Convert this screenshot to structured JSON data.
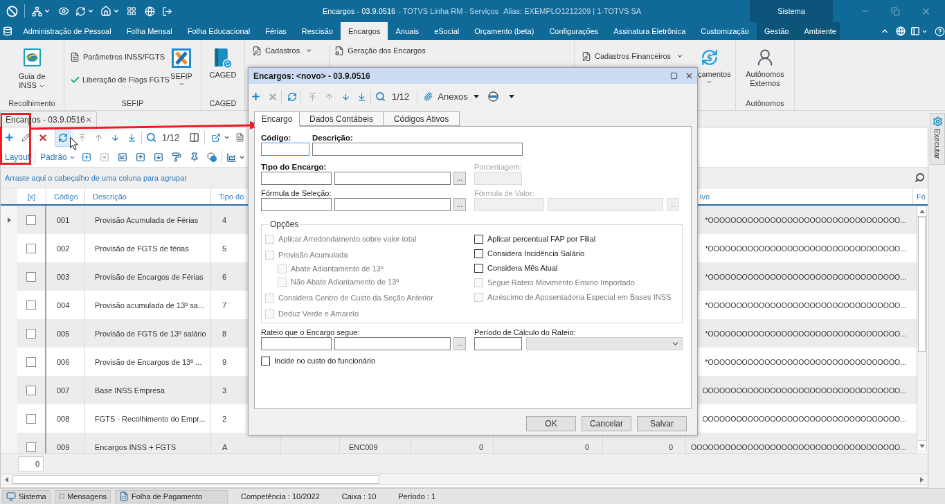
{
  "titlebar": {
    "document": "Encargos - 03.9.0516",
    "app": "- TOTVS Linha RM - Serviços",
    "alias": "Alias: EXEMPLO1212209 | 1-TOTVS SA",
    "context": "Sistema"
  },
  "menu": [
    {
      "label": "Administração de Pessoal",
      "selected": false,
      "contextual": false
    },
    {
      "label": "Folha Mensal",
      "selected": false,
      "contextual": false
    },
    {
      "label": "Folha Educacional",
      "selected": false,
      "contextual": false
    },
    {
      "label": "Férias",
      "selected": false,
      "contextual": false
    },
    {
      "label": "Rescisão",
      "selected": false,
      "contextual": false
    },
    {
      "label": "Encargos",
      "selected": true,
      "contextual": false
    },
    {
      "label": "Anuais",
      "selected": false,
      "contextual": false
    },
    {
      "label": "eSocial",
      "selected": false,
      "contextual": false
    },
    {
      "label": "Orçamento (beta)",
      "selected": false,
      "contextual": false
    },
    {
      "label": "Configurações",
      "selected": false,
      "contextual": false
    },
    {
      "label": "Assinatura Eletrônica",
      "selected": false,
      "contextual": false
    },
    {
      "label": "Customização",
      "selected": false,
      "contextual": false
    },
    {
      "label": "Gestão",
      "selected": false,
      "contextual": true
    },
    {
      "label": "Ambiente",
      "selected": false,
      "contextual": true
    }
  ],
  "ribbon": {
    "groups": [
      {
        "label": "Recolhimento",
        "items": [
          {
            "label": "Guia de INSS",
            "dropdown": true
          }
        ]
      },
      {
        "label": "SEFIP",
        "items": [
          {
            "label": "Parâmetros INSS/FGTS",
            "dropdown": false
          },
          {
            "label": "Liberação de Flags FGTS",
            "dropdown": false
          },
          {
            "label": "SEFIP",
            "dropdown": true
          }
        ]
      },
      {
        "label": "CAGED",
        "items": [
          {
            "label": "CAGED",
            "dropdown": false
          }
        ]
      },
      {
        "items": [
          {
            "label": "Cadastros",
            "dropdown": true
          },
          {
            "label": "Geração dos Encargos",
            "dropdown": false
          }
        ]
      },
      {
        "items": [
          {
            "label": "Cadastros Financeiros",
            "dropdown": true
          },
          {
            "label": "çamentos",
            "dropdown": true
          }
        ]
      },
      {
        "label": "Autônomos",
        "items": [
          {
            "label": "Autônomos Externos",
            "dropdown": false
          }
        ]
      }
    ]
  },
  "document_tab": {
    "label": "Encargos - 03.9.0516"
  },
  "grid_toolbar": {
    "counter": "1/12",
    "layout": "Layout",
    "view": "Padrão"
  },
  "grid": {
    "group_hint": "Arraste aqui o cabeçalho de uma coluna para agrupar",
    "columns": {
      "selector": "[x]",
      "code": "Código",
      "description": "Descrição",
      "column_4": "Tipo do",
      "column_10": "ivo",
      "column_11": "Fó"
    },
    "rows": [
      {
        "focused": true,
        "checked": false,
        "code": "001",
        "description": "Provisão Acumulada de Férias",
        "column_4": "4",
        "column_10": "*OOOOOOOOOOOOOOOOOOOOOOOOOOOOOOOOOO..."
      },
      {
        "focused": false,
        "checked": false,
        "code": "002",
        "description": "Provisão de FGTS de férias",
        "column_4": "5",
        "column_10": "*OOOOOOOOOOOOOOOOOOOOOOOOOOOOOOOOOO..."
      },
      {
        "focused": false,
        "checked": false,
        "code": "003",
        "description": "Provisão de Encargos de Férias",
        "column_4": "6",
        "column_10": "*OOOOOOOOOOOOOOOOOOOOOOOOOOOOOOOOOO..."
      },
      {
        "focused": false,
        "checked": false,
        "code": "004",
        "description": "Provisão acumulada de 13º sa...",
        "column_4": "7",
        "column_10": "*OOOOOOOOOOOOOOOOOOOOOOOOOOOOOOOOOO..."
      },
      {
        "focused": false,
        "checked": false,
        "code": "005",
        "description": "Provisão de FGTS de 13º salário",
        "column_4": "8",
        "column_10": "*OOOOOOOOOOOOOOOOOOOOOOOOOOOOOOOOOO..."
      },
      {
        "focused": false,
        "checked": false,
        "code": "006",
        "description": "Provisão de Encargos de 13º ...",
        "column_4": "9",
        "column_10": "*OOOOOOOOOOOOOOOOOOOOOOOOOOOOOOOOOO..."
      },
      {
        "focused": false,
        "checked": false,
        "code": "007",
        "description": "Base INSS Empresa",
        "column_4": "3",
        "column_10": "OOOOOOOOOOOOOOOOOOOOOOOOOOOOOOOOOOO..."
      },
      {
        "focused": false,
        "checked": false,
        "code": "008",
        "description": "FGTS - Recolhimento do Empr...",
        "column_4": "2",
        "column_10": "OOOOOOOOOOOOOOOOOOOOOOOOOOOOOOOOOOO..."
      },
      {
        "focused": false,
        "checked": false,
        "code": "009",
        "description": "Encargos INSS + FGTS",
        "column_4": "A",
        "column_6": "ENC009",
        "column_7": "0",
        "column_8": "0",
        "column_9": "0",
        "column_10": "OOOOOOOOOOOOOOOOOOOOOOOOOOOOOOOOOOOOO..."
      }
    ],
    "footer": "0"
  },
  "side_panel": {
    "label": "Executar"
  },
  "dialog": {
    "title": "Encargos: <novo> - 03.9.0516",
    "counter": "1/12",
    "attachments": "Anexos",
    "tabs": [
      {
        "label": "Encargo",
        "selected": true
      },
      {
        "label": "Dados Contábeis",
        "selected": false
      },
      {
        "label": "Códigos Ativos",
        "selected": false
      }
    ],
    "code": {
      "label": "Código:",
      "required": true,
      "focused": true
    },
    "description": {
      "label": "Descrição:",
      "required": true,
      "focused": false
    },
    "charge_type": {
      "label": "Tipo do Encargo:",
      "required": true,
      "disabled": false,
      "lookup": "..."
    },
    "percentage": {
      "label": "Porcentagem:",
      "disabled": true
    },
    "selection_formula": {
      "label": "Fórmula de Seleção:",
      "required": false,
      "disabled": false,
      "lookup": "..."
    },
    "value_formula": {
      "label": "Fórmula de Valor:",
      "disabled": true,
      "lookup": "..."
    },
    "options": {
      "legend": "Opções",
      "left": [
        {
          "label": "Aplicar Arredondamento sobre valor total",
          "checked": false,
          "disabled": true
        },
        {
          "label": "Provisão Acumulada",
          "checked": false,
          "disabled": true,
          "children": [
            {
              "label": "Abate Adiantamento de 13º",
              "checked": false,
              "disabled": true
            },
            {
              "label": "Não Abate Adiantamento de 13º",
              "checked": false,
              "disabled": true
            }
          ]
        },
        {
          "label": "Considera Centro de Custo da Seção Anterior",
          "checked": false,
          "disabled": true
        },
        {
          "label": "Deduz Verde e Amarelo",
          "checked": false,
          "disabled": true
        }
      ],
      "right": [
        {
          "label": "Aplicar percentual FAP por Filial",
          "checked": false,
          "disabled": false
        },
        {
          "label": "Considera Incidência Salário",
          "checked": false,
          "disabled": false
        },
        {
          "label": "Considera Mês Atual",
          "checked": false,
          "disabled": false
        },
        {
          "label": "Segue Rateio Movimento Ensino Importado",
          "checked": false,
          "disabled": true
        },
        {
          "label": "Acréscimo de Aposentadoria Especial em Bases INSS",
          "checked": false,
          "disabled": true
        }
      ]
    },
    "apportionment": {
      "label": "Rateio que o Encargo segue:",
      "required": false,
      "disabled": false,
      "lookup": "..."
    },
    "calculation_period": {
      "label": "Período de Cálculo do Rateio:",
      "select_disabled": true
    },
    "cost_checkbox": {
      "label": "Incide no custo do funcionário",
      "checked": false,
      "disabled": false
    },
    "buttons": [
      "OK",
      "Cancelar",
      "Salvar"
    ]
  },
  "status_bar": {
    "buttons": [
      {
        "label": "Sistema"
      },
      {
        "label": "Mensagens"
      },
      {
        "label": "Folha de Pagamento"
      }
    ],
    "info": [
      "Competência : 10/2022",
      "Caixa : 10",
      "Período : 1"
    ]
  }
}
